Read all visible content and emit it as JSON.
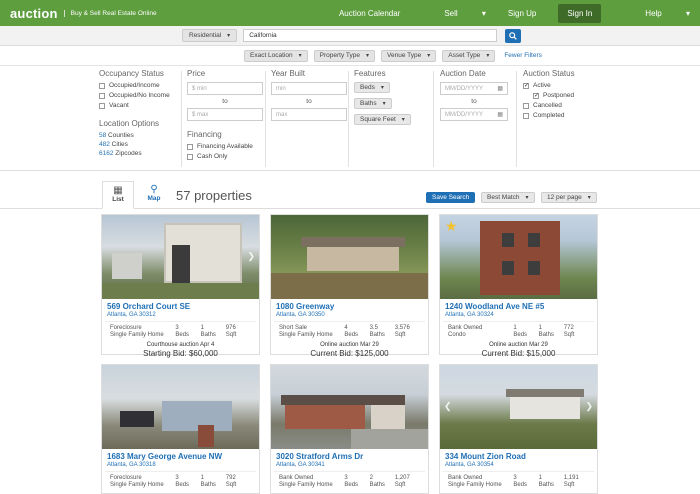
{
  "header": {
    "logo": "auction",
    "tagline": "Buy & Sell Real Estate Online",
    "nav": [
      "Auction Calendar",
      "Sell",
      "Sign Up",
      "Sign In",
      "Help"
    ]
  },
  "search": {
    "type": "Residential",
    "location": "California"
  },
  "filters": {
    "buttons": [
      "Exact Location",
      "Property Type",
      "Venue Type",
      "Asset Type"
    ],
    "fewer": "Fewer Filters"
  },
  "panel": {
    "occupancy": {
      "title": "Occupancy Status",
      "options": [
        "Occupied/Income",
        "Occupied/No Income",
        "Vacant"
      ]
    },
    "location": {
      "title": "Location Options",
      "items": [
        {
          "n": "58",
          "l": "Counties"
        },
        {
          "n": "482",
          "l": "Cities"
        },
        {
          "n": "6162",
          "l": "Zipcodes"
        }
      ]
    },
    "price": {
      "title": "Price",
      "min": "$ min",
      "to": "to",
      "max": "$ max"
    },
    "financing": {
      "title": "Financing",
      "options": [
        "Financing Available",
        "Cash Only"
      ]
    },
    "year": {
      "title": "Year Built",
      "min": "min",
      "to": "to",
      "max": "max"
    },
    "features": {
      "title": "Features",
      "options": [
        "Beds",
        "Baths",
        "Square Feet"
      ]
    },
    "date": {
      "title": "Auction Date",
      "from": "MM/DD/YYYY",
      "to": "to",
      "until": "MM/DD/YYYY"
    },
    "status": {
      "title": "Auction Status",
      "options": [
        {
          "l": "Active",
          "c": true,
          "i": false
        },
        {
          "l": "Postponed",
          "c": true,
          "i": true
        },
        {
          "l": "Cancelled",
          "c": false,
          "i": false
        },
        {
          "l": "Completed",
          "c": false,
          "i": false
        }
      ]
    }
  },
  "results": {
    "list": "List",
    "map": "Map",
    "count": "57 properties",
    "save": "Save Search",
    "sort": "Best Match",
    "perpage": "12 per page"
  },
  "cards": [
    {
      "addr": "569 Orchard Court SE",
      "city": "Atlanta, GA 30312",
      "type1": "Foreclosure",
      "type2": "Single Family Home",
      "beds": "3",
      "baths": "1",
      "sqft": "976",
      "auction": "Courthouse auction Apr 4",
      "bid": "Starting Bid: $60,000",
      "star": false
    },
    {
      "addr": "1080 Greenway",
      "city": "Atlanta, GA 30350",
      "type1": "Short Sale",
      "type2": "Single Family Home",
      "beds": "4",
      "baths": "3.5",
      "sqft": "3,576",
      "auction": "Online auction Mar 29",
      "bid": "Current Bid: $125,000",
      "star": false
    },
    {
      "addr": "1240 Woodland Ave NE #5",
      "city": "Atlanta, GA 30324",
      "type1": "Bank Owned",
      "type2": "Condo",
      "beds": "1",
      "baths": "1",
      "sqft": "772",
      "auction": "Online auction Mar 29",
      "bid": "Current Bid: $15,000",
      "star": true
    },
    {
      "addr": "1683 Mary George Avenue NW",
      "city": "Atlanta, GA 30318",
      "type1": "Foreclosure",
      "type2": "Single Family Home",
      "beds": "3",
      "baths": "1",
      "sqft": "792",
      "star": false
    },
    {
      "addr": "3020 Stratford Arms Dr",
      "city": "Atlanta, GA 30341",
      "type1": "Bank Owned",
      "type2": "Single Family Home",
      "beds": "3",
      "baths": "2",
      "sqft": "1,207",
      "star": false
    },
    {
      "addr": "334 Mount Zion Road",
      "city": "Atlanta, GA 30354",
      "type1": "Bank Owned",
      "type2": "Single Family Home",
      "beds": "3",
      "baths": "1",
      "sqft": "1,191",
      "star": false
    }
  ],
  "labels": {
    "beds": "Beds",
    "baths": "Baths",
    "sqft": "Sqft"
  }
}
